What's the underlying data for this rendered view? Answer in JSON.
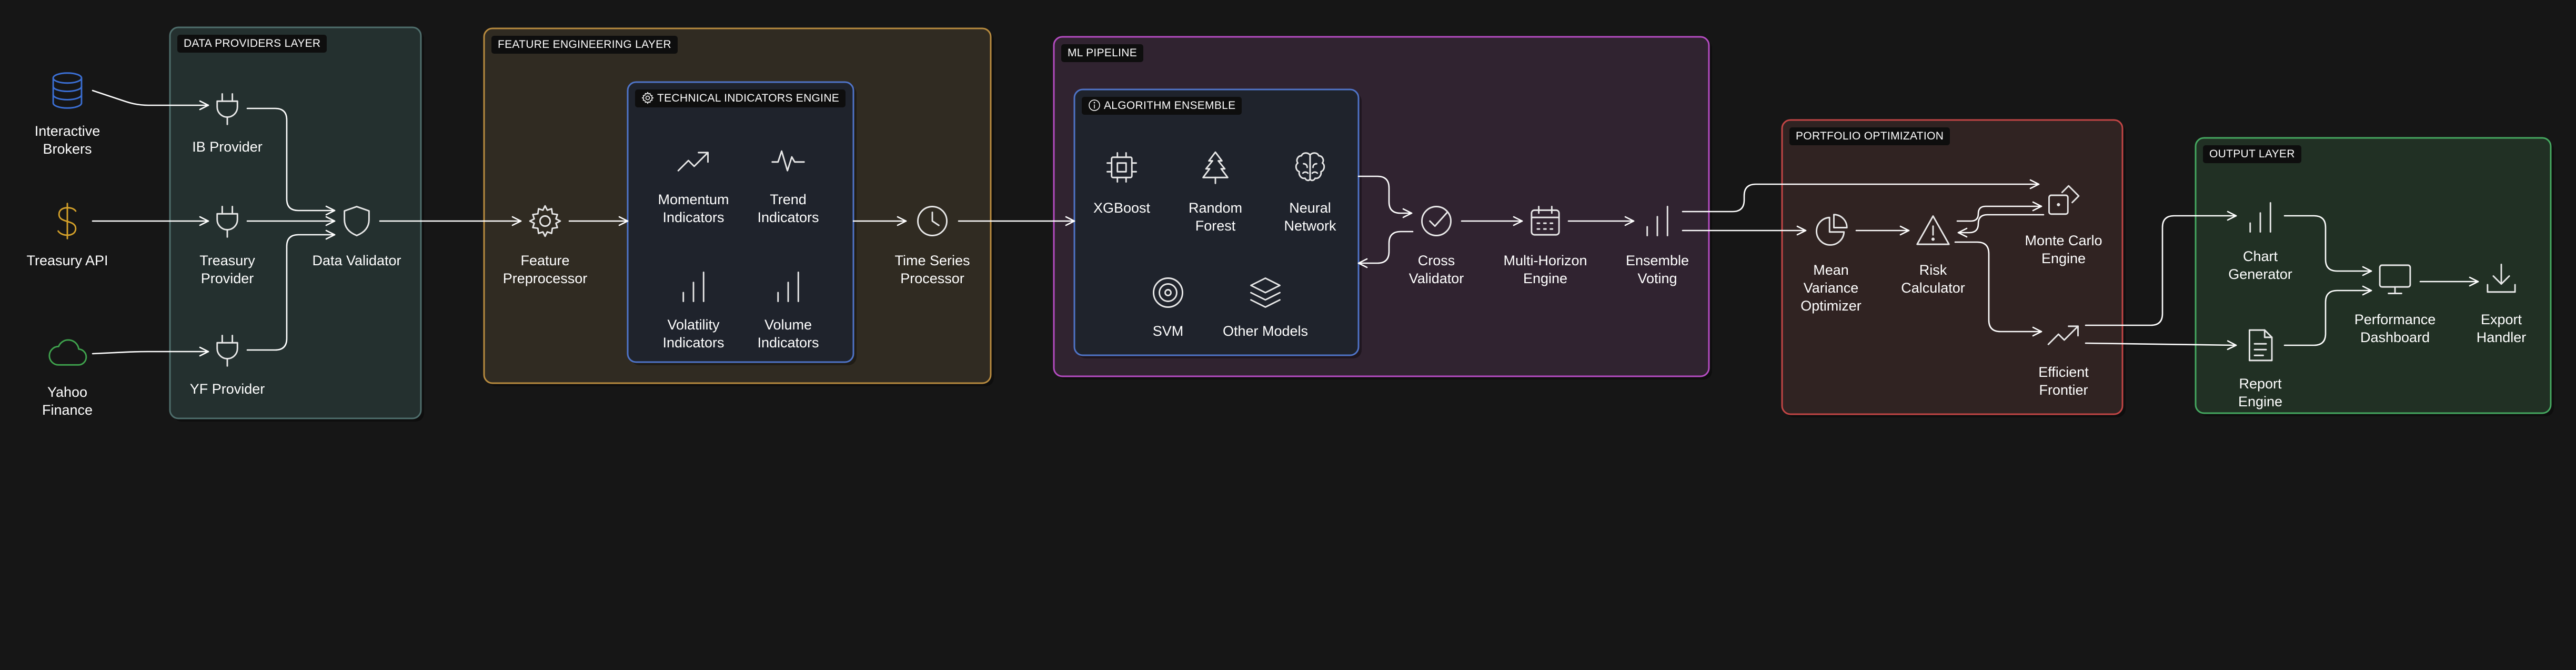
{
  "groups": {
    "data_providers": {
      "title": "DATA PROVIDERS LAYER",
      "stroke": "#4f6e6c",
      "fill": "#24302f"
    },
    "feature_engineering": {
      "title": "FEATURE ENGINEERING LAYER",
      "stroke": "#b88b3f",
      "fill": "#302b22"
    },
    "technical_indicators": {
      "title": "TECHNICAL INDICATORS ENGINE",
      "stroke": "#4f74c8",
      "fill": "#1f232c"
    },
    "ml_pipeline": {
      "title": "ML PIPELINE",
      "stroke": "#b54cc2",
      "fill": "#302330"
    },
    "algorithm_ensemble": {
      "title": "ALGORITHM ENSEMBLE",
      "stroke": "#4f74c8",
      "fill": "#1f232c"
    },
    "portfolio_optimization": {
      "title": "PORTFOLIO OPTIMIZATION",
      "stroke": "#c24545",
      "fill": "#302322"
    },
    "output": {
      "title": "OUTPUT LAYER",
      "stroke": "#45a860",
      "fill": "#213024"
    }
  },
  "nodes": {
    "interactive_brokers": {
      "label": "Interactive\nBrokers",
      "icon": "database-icon",
      "color": "#3b6fd4"
    },
    "treasury_api": {
      "label": "Treasury API",
      "icon": "dollar-icon",
      "color": "#d4a12a"
    },
    "yahoo_finance": {
      "label": "Yahoo\nFinance",
      "icon": "cloud-icon",
      "color": "#3fa34d"
    },
    "ib_provider": {
      "label": "IB Provider",
      "icon": "plug-icon"
    },
    "treasury_provider": {
      "label": "Treasury\nProvider",
      "icon": "plug-icon"
    },
    "yf_provider": {
      "label": "YF Provider",
      "icon": "plug-icon"
    },
    "data_validator": {
      "label": "Data Validator",
      "icon": "shield-icon"
    },
    "feature_preprocessor": {
      "label": "Feature\nPreprocessor",
      "icon": "gear-icon"
    },
    "momentum_indicators": {
      "label": "Momentum\nIndicators",
      "icon": "trend-up-icon"
    },
    "trend_indicators": {
      "label": "Trend\nIndicators",
      "icon": "pulse-icon"
    },
    "volatility_indicators": {
      "label": "Volatility\nIndicators",
      "icon": "bar-chart-icon"
    },
    "volume_indicators": {
      "label": "Volume\nIndicators",
      "icon": "bar-chart-icon"
    },
    "time_series_processor": {
      "label": "Time Series\nProcessor",
      "icon": "clock-icon"
    },
    "xgboost": {
      "label": "XGBoost",
      "icon": "chip-icon"
    },
    "random_forest": {
      "label": "Random\nForest",
      "icon": "tree-icon"
    },
    "neural_network": {
      "label": "Neural\nNetwork",
      "icon": "brain-icon"
    },
    "svm": {
      "label": "SVM",
      "icon": "target-icon"
    },
    "other_models": {
      "label": "Other Models",
      "icon": "layers-icon"
    },
    "cross_validator": {
      "label": "Cross\nValidator",
      "icon": "check-circle-icon"
    },
    "multi_horizon_engine": {
      "label": "Multi-Horizon\nEngine",
      "icon": "calendar-icon"
    },
    "ensemble_voting": {
      "label": "Ensemble\nVoting",
      "icon": "bar-chart-icon"
    },
    "mean_variance_optimizer": {
      "label": "Mean\nVariance\nOptimizer",
      "icon": "pie-chart-icon"
    },
    "risk_calculator": {
      "label": "Risk\nCalculator",
      "icon": "warning-icon"
    },
    "monte_carlo_engine": {
      "label": "Monte Carlo\nEngine",
      "icon": "dice-icon"
    },
    "efficient_frontier": {
      "label": "Efficient\nFrontier",
      "icon": "trend-up-icon"
    },
    "chart_generator": {
      "label": "Chart\nGenerator",
      "icon": "bar-chart-icon"
    },
    "report_engine": {
      "label": "Report\nEngine",
      "icon": "document-icon"
    },
    "performance_dashboard": {
      "label": "Performance\nDashboard",
      "icon": "monitor-icon"
    },
    "export_handler": {
      "label": "Export\nHandler",
      "icon": "download-icon"
    }
  },
  "edges": [
    [
      "interactive_brokers",
      "ib_provider"
    ],
    [
      "treasury_api",
      "treasury_provider"
    ],
    [
      "yahoo_finance",
      "yf_provider"
    ],
    [
      "ib_provider",
      "data_validator"
    ],
    [
      "treasury_provider",
      "data_validator"
    ],
    [
      "yf_provider",
      "data_validator"
    ],
    [
      "data_validator",
      "feature_preprocessor"
    ],
    [
      "feature_preprocessor",
      "technical_indicators"
    ],
    [
      "technical_indicators",
      "time_series_processor"
    ],
    [
      "time_series_processor",
      "algorithm_ensemble"
    ],
    [
      "algorithm_ensemble",
      "cross_validator"
    ],
    [
      "cross_validator",
      "algorithm_ensemble"
    ],
    [
      "cross_validator",
      "multi_horizon_engine"
    ],
    [
      "multi_horizon_engine",
      "ensemble_voting"
    ],
    [
      "ensemble_voting",
      "mean_variance_optimizer"
    ],
    [
      "ensemble_voting",
      "monte_carlo_engine"
    ],
    [
      "mean_variance_optimizer",
      "risk_calculator"
    ],
    [
      "risk_calculator",
      "monte_carlo_engine"
    ],
    [
      "monte_carlo_engine",
      "risk_calculator"
    ],
    [
      "risk_calculator",
      "efficient_frontier"
    ],
    [
      "efficient_frontier",
      "chart_generator"
    ],
    [
      "efficient_frontier",
      "report_engine"
    ],
    [
      "chart_generator",
      "performance_dashboard"
    ],
    [
      "report_engine",
      "performance_dashboard"
    ],
    [
      "performance_dashboard",
      "export_handler"
    ]
  ],
  "colors": {
    "background": "#161616",
    "edge": "#ffffff",
    "icon": "#e8e8e8",
    "tag_background": "#0e0e0e"
  }
}
